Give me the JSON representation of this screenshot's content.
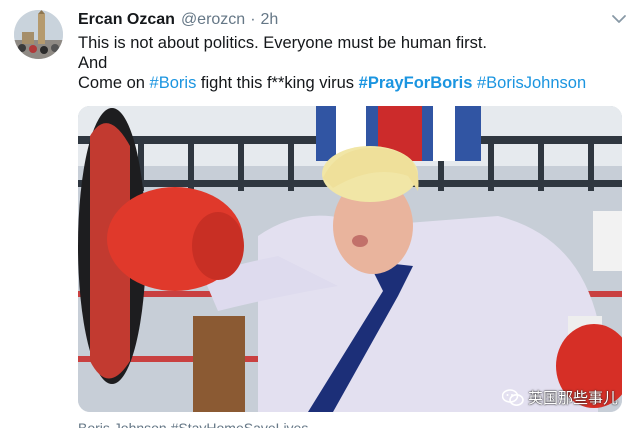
{
  "tweet": {
    "display_name": "Ercan Ozcan",
    "handle": "@erozcn",
    "separator": "·",
    "time": "2h",
    "text_line1": "This is not about politics. Everyone must be human first.",
    "text_line2": "And",
    "text_line3_prefix": "Come on ",
    "hashtag_boris": "#Boris",
    "text_line3_middle": " fight this f**king virus ",
    "hashtag_prayforboris": "#PrayForBoris",
    "text_space": " ",
    "hashtag_borisjohnson": "#BorisJohnson"
  },
  "media": {
    "watermark_text": "英国那些事儿",
    "caption": "Boris Johnson #StayHomeSaveLives"
  },
  "icons": {
    "caret": "chevron-down-icon",
    "watermark": "wechat-icon"
  },
  "colors": {
    "name": "#14171a",
    "secondary": "#657786",
    "hashtag": "#1b95e0"
  }
}
